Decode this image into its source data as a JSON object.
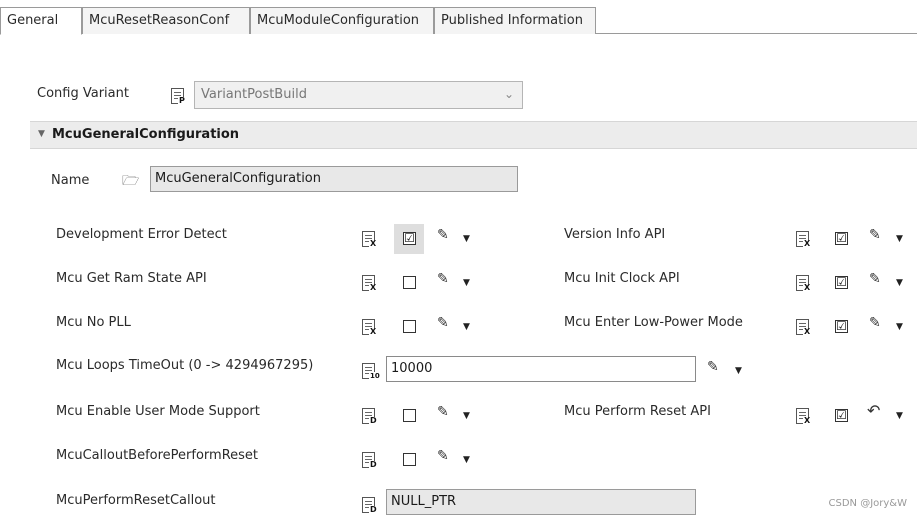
{
  "tabs": [
    {
      "label": "General"
    },
    {
      "label": "McuResetReasonConf"
    },
    {
      "label": "McuModuleConfiguration"
    },
    {
      "label": "Published Information"
    }
  ],
  "config_variant": {
    "label": "Config Variant",
    "value": "VariantPostBuild",
    "icon_badge": "P"
  },
  "section": {
    "title": "McuGeneralConfiguration"
  },
  "name_field": {
    "label": "Name",
    "value": "McuGeneralConfiguration"
  },
  "left_rows": [
    {
      "label": "Development Error Detect",
      "checked": true
    },
    {
      "label": "Mcu Get Ram State API",
      "checked": false
    },
    {
      "label": "Mcu No PLL",
      "checked": false
    },
    {
      "label": "Mcu Loops TimeOut (0 -> 4294967295)",
      "value": "10000"
    },
    {
      "label": "Mcu Enable User Mode Support",
      "checked": false
    },
    {
      "label": "McuCalloutBeforePerformReset",
      "checked": false
    },
    {
      "label": "McuPerformResetCallout",
      "value": "NULL_PTR"
    }
  ],
  "right_rows": [
    {
      "label": "Version Info API",
      "checked": true
    },
    {
      "label": "Mcu Init Clock API",
      "checked": true
    },
    {
      "label": "Mcu Enter Low-Power Mode",
      "checked": true
    },
    {
      "label": "Mcu Perform Reset API",
      "checked": true
    }
  ],
  "icons": {
    "check_mark": "☑",
    "pencil": "✎",
    "dropdown": "▼",
    "folder": "🗁",
    "chevron": "⌄",
    "badge_x": "X",
    "badge_d": "D",
    "badge_10": "10"
  },
  "watermark": "CSDN @Jory&W"
}
